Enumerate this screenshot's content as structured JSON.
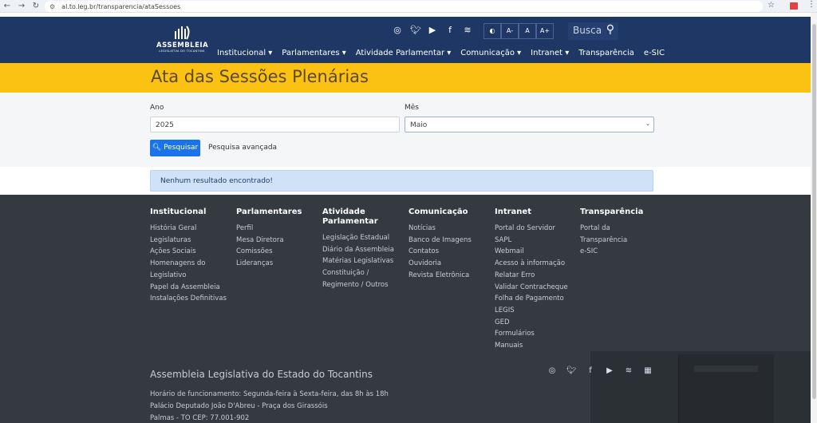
{
  "browser": {
    "url": "al.to.leg.br/transparencia/ataSessoes",
    "back": "←",
    "forward": "→",
    "reload": "↻",
    "star": "☆",
    "menu": "⋮"
  },
  "header": {
    "logo_name": "ASSEMBLEIA",
    "logo_sub": "LEGISLATIVA DO TOCANTINS",
    "social": [
      "instagram-icon",
      "twitter-icon",
      "youtube-icon",
      "facebook-icon",
      "rss-icon"
    ],
    "access_buttons": [
      "◐",
      "A-",
      "A",
      "A+"
    ],
    "search_placeholder": "Busca",
    "nav": [
      {
        "label": "Institucional ▾"
      },
      {
        "label": "Parlamentares ▾"
      },
      {
        "label": "Atividade Parlamentar ▾"
      },
      {
        "label": "Comunicação ▾"
      },
      {
        "label": "Intranet ▾"
      },
      {
        "label": "Transparência"
      },
      {
        "label": "e-SIC"
      }
    ]
  },
  "page": {
    "title": "Ata das Sessões Plenárias"
  },
  "form": {
    "year_label": "Ano",
    "year_value": "2025",
    "month_label": "Mês",
    "month_value": "Maio",
    "search_button": "Pesquisar",
    "advanced_link": "Pesquisa avançada"
  },
  "alert": {
    "text": "Nenhum resultado encontrado!"
  },
  "footer": {
    "columns": [
      {
        "title": "Institucional",
        "links": [
          "História Geral",
          "Legislaturas",
          "Ações Sociais",
          "Homenagens do",
          "Legislativo",
          "Papel da Assembleia",
          "Instalações Definitivas"
        ]
      },
      {
        "title": "Parlamentares",
        "links": [
          "Perfil",
          "Mesa Diretora",
          "Comissões",
          "Lideranças"
        ]
      },
      {
        "title": "Atividade Parlamentar",
        "links": [
          "Legislação Estadual",
          "Diário da Assembleia",
          "Matérias Legislativas",
          "Constituição /",
          "Regimento / Outros"
        ]
      },
      {
        "title": "Comunicação",
        "links": [
          "Notícias",
          "Banco de Imagens",
          "Contatos",
          "Ouvidoria",
          "Revista Eletrônica"
        ]
      },
      {
        "title": "Intranet",
        "links": [
          "Portal do Servidor",
          "SAPL",
          "Webmail",
          "Acesso à informação",
          "Relatar Erro",
          "Validar Contracheque",
          "Folha de Pagamento",
          "LEGIS",
          "GED",
          "Formulários",
          "Manuais"
        ]
      },
      {
        "title": "Transparência",
        "links": [
          "Portal da",
          "Transparência",
          "e-SIC"
        ]
      }
    ],
    "org_name": "Assembleia Legislativa do Estado do Tocantins",
    "hours": "Horário de funcionamento: Segunda-feira à Sexta-feira, das 8h às 18h",
    "address": "Palácio Deputado João D'Abreu - Praça dos Girassóis",
    "city": "Palmas - TO CEP: 77.001-902",
    "social": [
      "instagram-icon",
      "twitter-icon",
      "facebook-icon",
      "youtube-icon",
      "rss-icon",
      "map-icon"
    ]
  }
}
